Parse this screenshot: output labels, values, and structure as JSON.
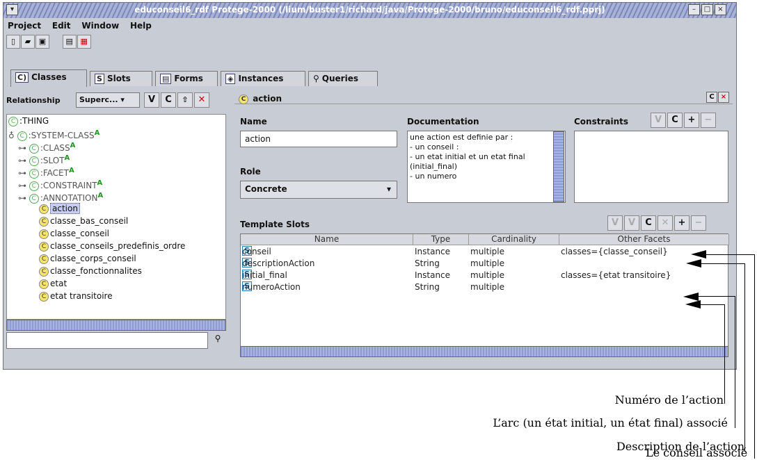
{
  "window": {
    "title": "educonseil6_rdf  Protege-2000    (/lium/buster1/richard/java/Protege-2000/bruno/educonseil6_rdf.pprj)"
  },
  "menu": [
    "Project",
    "Edit",
    "Window",
    "Help"
  ],
  "tabs": [
    {
      "label": "Classes",
      "icon": "C"
    },
    {
      "label": "Slots",
      "icon": "S"
    },
    {
      "label": "Forms",
      "icon": "F"
    },
    {
      "label": "Instances",
      "icon": "I"
    },
    {
      "label": "Queries",
      "icon": "Q"
    }
  ],
  "left": {
    "relationship_label": "Relationship",
    "relationship_value": "Superc...",
    "tree": [
      {
        "label": ":THING",
        "abstract": false
      },
      {
        "label": ":SYSTEM-CLASS",
        "abstract": true
      },
      {
        "label": ":CLASS",
        "abstract": true
      },
      {
        "label": ":SLOT",
        "abstract": true
      },
      {
        "label": ":FACET",
        "abstract": true
      },
      {
        "label": ":CONSTRAINT",
        "abstract": true
      },
      {
        "label": ":ANNOTATION",
        "abstract": true
      },
      {
        "label": "action",
        "abstract": false
      },
      {
        "label": "classe_bas_conseil",
        "abstract": false
      },
      {
        "label": "classe_conseil",
        "abstract": false
      },
      {
        "label": "classe_conseils_predefinis_ordre",
        "abstract": false
      },
      {
        "label": "classe_corps_conseil",
        "abstract": false
      },
      {
        "label": "classe_fonctionnalites",
        "abstract": false
      },
      {
        "label": "etat",
        "abstract": false
      },
      {
        "label": "etat transitoire",
        "abstract": false
      }
    ],
    "abstract_marker": "A"
  },
  "right": {
    "header": "action",
    "name_label": "Name",
    "name_value": "action",
    "doc_label": "Documentation",
    "doc_lines": [
      "une action est definie par :",
      "- un conseil :",
      "- un etat initial et un etat final",
      "(initial_final)",
      "- un numero"
    ],
    "constraints_label": "Constraints",
    "role_label": "Role",
    "role_value": "Concrete",
    "template_label": "Template Slots",
    "columns": [
      "Name",
      "Type",
      "Cardinality",
      "Other Facets"
    ],
    "rows": [
      {
        "name": "conseil",
        "type": "Instance",
        "card": "multiple",
        "facets": "classes={classe_conseil}"
      },
      {
        "name": "descriptionAction",
        "type": "String",
        "card": "multiple",
        "facets": ""
      },
      {
        "name": "initial_final",
        "type": "Instance",
        "card": "multiple",
        "facets": "classes={etat transitoire}"
      },
      {
        "name": "numeroAction",
        "type": "String",
        "card": "multiple",
        "facets": ""
      }
    ]
  },
  "captions": {
    "numero": "Numéro de l’action",
    "arc": "L’arc (un état initial, un état final) associé",
    "description": "Description de l’action",
    "conseil": "Le conseil associé"
  }
}
